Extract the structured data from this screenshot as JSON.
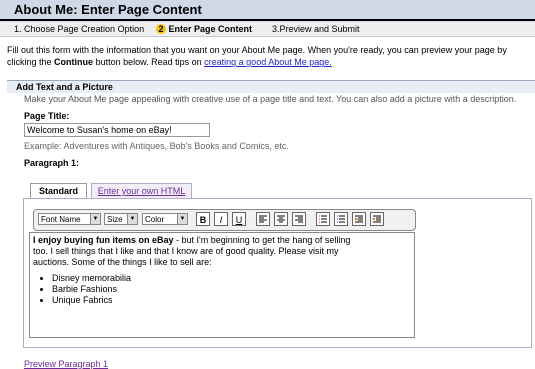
{
  "header": {
    "title": "About Me: Enter Page Content"
  },
  "steps": [
    {
      "label": "1. Choose Page Creation Option"
    },
    {
      "number": "2",
      "label": "Enter Page Content"
    },
    {
      "label": "3.Preview and Submit"
    }
  ],
  "intro": {
    "line1": "Fill out this form with the information that you want on your About Me page. When you're ready, you can preview your page by",
    "line2_prefix": "clicking the",
    "line2_bold": "Continue",
    "line2_mid": "button below. Read tips on",
    "tips_link": "creating a good About Me page."
  },
  "section": {
    "heading": "Add Text and a Picture",
    "description": "Make your About Me page appealing with creative use of a page title and text. You can also add a picture with a description."
  },
  "page_title": {
    "label": "Page Title:",
    "value": "Welcome to Susan's home on eBay!",
    "example": "Example: Adventures with Antiques, Bob's Books and Comics, etc."
  },
  "paragraph": {
    "label": "Paragraph 1:",
    "tabs": [
      "Standard",
      "Enter your own HTML"
    ],
    "toolbar": {
      "font_name": "Font Name",
      "size": "Size",
      "color": "Color",
      "bold": "B",
      "italic": "I",
      "underline": "U"
    },
    "content": {
      "bold_text": "I enjoy buying fun items on eBay",
      "text_line1": " - but I'm beginning to get the hang of selling",
      "text_line2": "too. I sell things that I like and that I know are of good quality. Please visit my",
      "text_line3": "auctions. Some of the things I like to sell are:",
      "list": [
        "Disney memorabilia",
        "Barbie Fashions",
        "Unique Fabrics"
      ]
    }
  },
  "preview_link": "Preview Paragraph 1",
  "colors": {
    "header_bg": "#cfd8e6",
    "step_badge": "#f5c600",
    "link": "#2222cc",
    "visited_link": "#6c2c9b"
  }
}
